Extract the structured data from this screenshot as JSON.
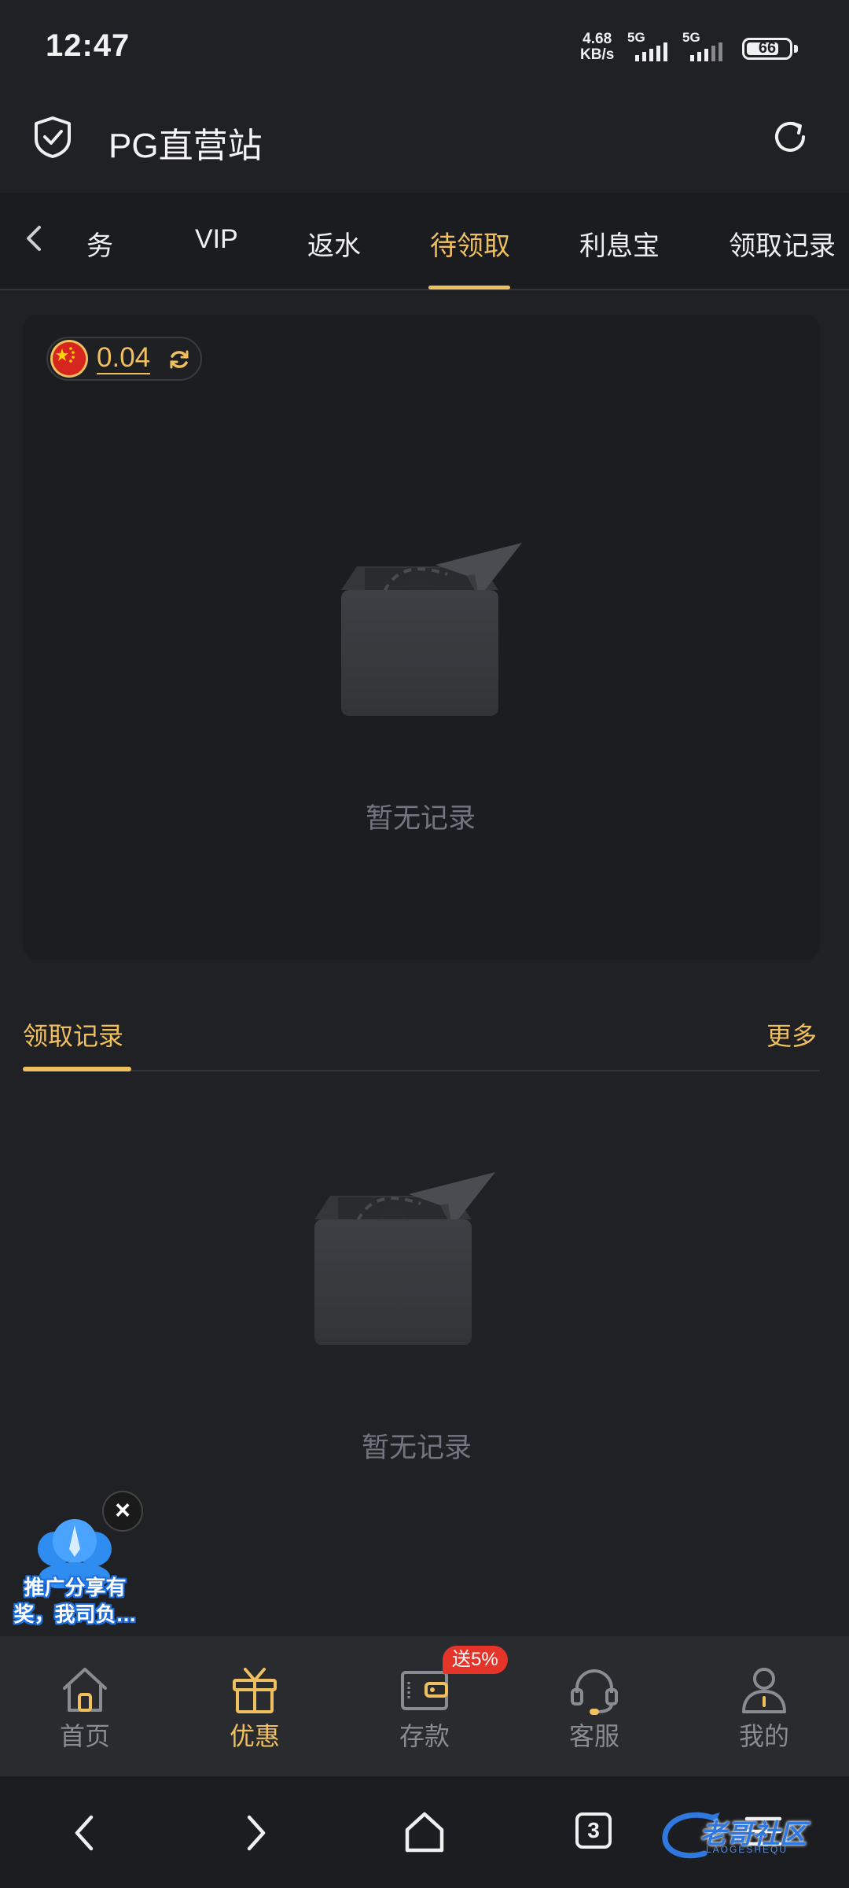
{
  "status_bar": {
    "time": "12:47",
    "net_speed_value": "4.68",
    "net_speed_unit": "KB/s",
    "sim1": "5G",
    "sim2": "5G",
    "battery": "66"
  },
  "header": {
    "title": "PG直营站"
  },
  "tabs": [
    {
      "label": "任务",
      "active": false
    },
    {
      "label": "VIP",
      "active": false
    },
    {
      "label": "返水",
      "active": false
    },
    {
      "label": "待领取",
      "active": true
    },
    {
      "label": "利息宝",
      "active": false
    },
    {
      "label": "领取记录",
      "active": false
    }
  ],
  "pending": {
    "balance": "0.04",
    "empty_text": "暂无记录"
  },
  "records": {
    "title": "领取记录",
    "more": "更多",
    "empty_text": "暂无记录"
  },
  "promo": {
    "close": "×",
    "text_line1": "推广分享有",
    "text_line2": "奖，我司负…"
  },
  "bottom_nav": [
    {
      "label": "首页",
      "icon": "home-icon",
      "active": false
    },
    {
      "label": "优惠",
      "icon": "gift-icon",
      "active": true
    },
    {
      "label": "存款",
      "icon": "wallet-icon",
      "active": false
    },
    {
      "label": "客服",
      "icon": "headset-icon",
      "active": false
    },
    {
      "label": "我的",
      "icon": "user-icon",
      "active": false
    }
  ],
  "deposit_badge": "送5%",
  "system_nav": {
    "tab_count": "3"
  },
  "watermark": {
    "text": "老哥社区",
    "sub": "LAOGESHEQU"
  },
  "colors": {
    "accent": "#f1c05e",
    "background": "#202124",
    "badge": "#e5352b"
  }
}
